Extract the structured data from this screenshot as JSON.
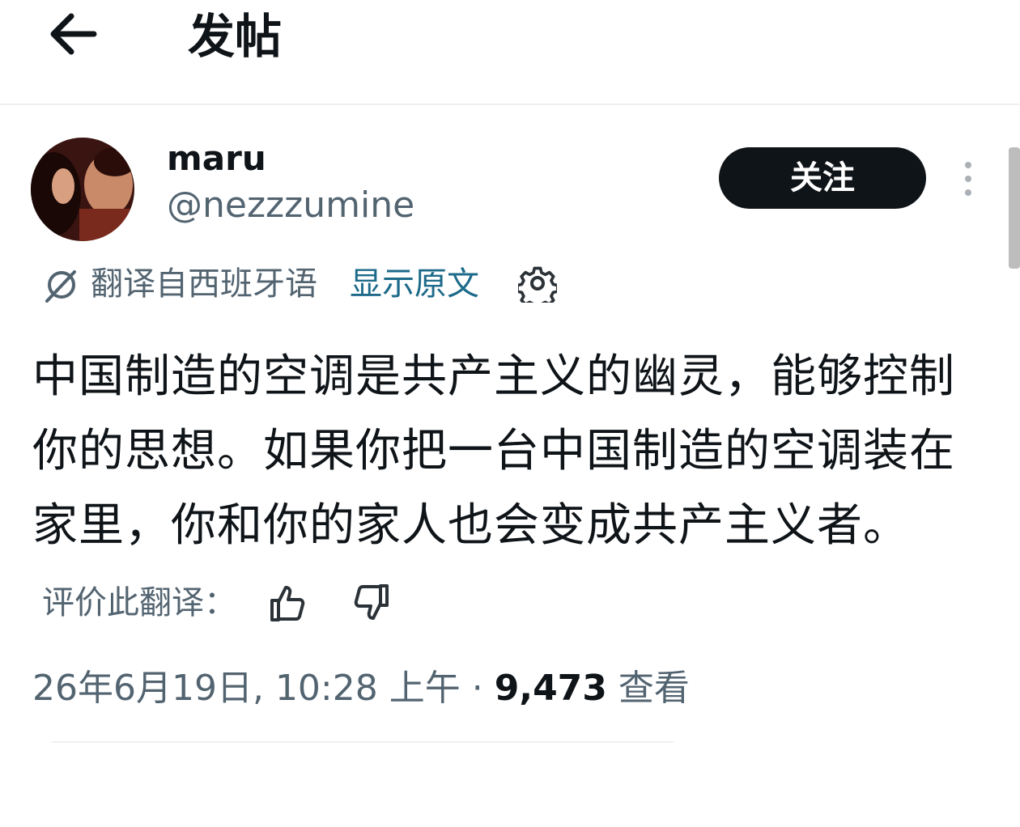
{
  "header": {
    "back_icon": "arrow-left-icon",
    "title": "发帖"
  },
  "author": {
    "display_name": "maru",
    "handle": "@nezzzumine",
    "follow_label": "关注",
    "more_icon": "more-vertical-icon"
  },
  "translation": {
    "icon": "translate-icon",
    "label": "翻译自西班牙语",
    "show_original": "显示原文",
    "settings_icon": "gear-icon"
  },
  "tweet": {
    "lines": [
      "中国制造的空调是共产主义的幽灵，能够控制",
      "你的思想。如果你把一台中国制造的空调装在",
      "家里，你和你的家人也会变成共产主义者。"
    ]
  },
  "rating": {
    "label": "评价此翻译：",
    "thumb_up_icon": "thumbs-up-icon",
    "thumb_down_icon": "thumbs-down-icon"
  },
  "meta": {
    "timestamp": "26年6月19日, 10:28 上午",
    "separator": "·",
    "views_count": "9,473",
    "views_label": "查看"
  },
  "colors": {
    "text_primary": "#0f1419",
    "text_secondary": "#536471",
    "link": "#1d6a8a",
    "follow_bg": "#0f1419"
  }
}
